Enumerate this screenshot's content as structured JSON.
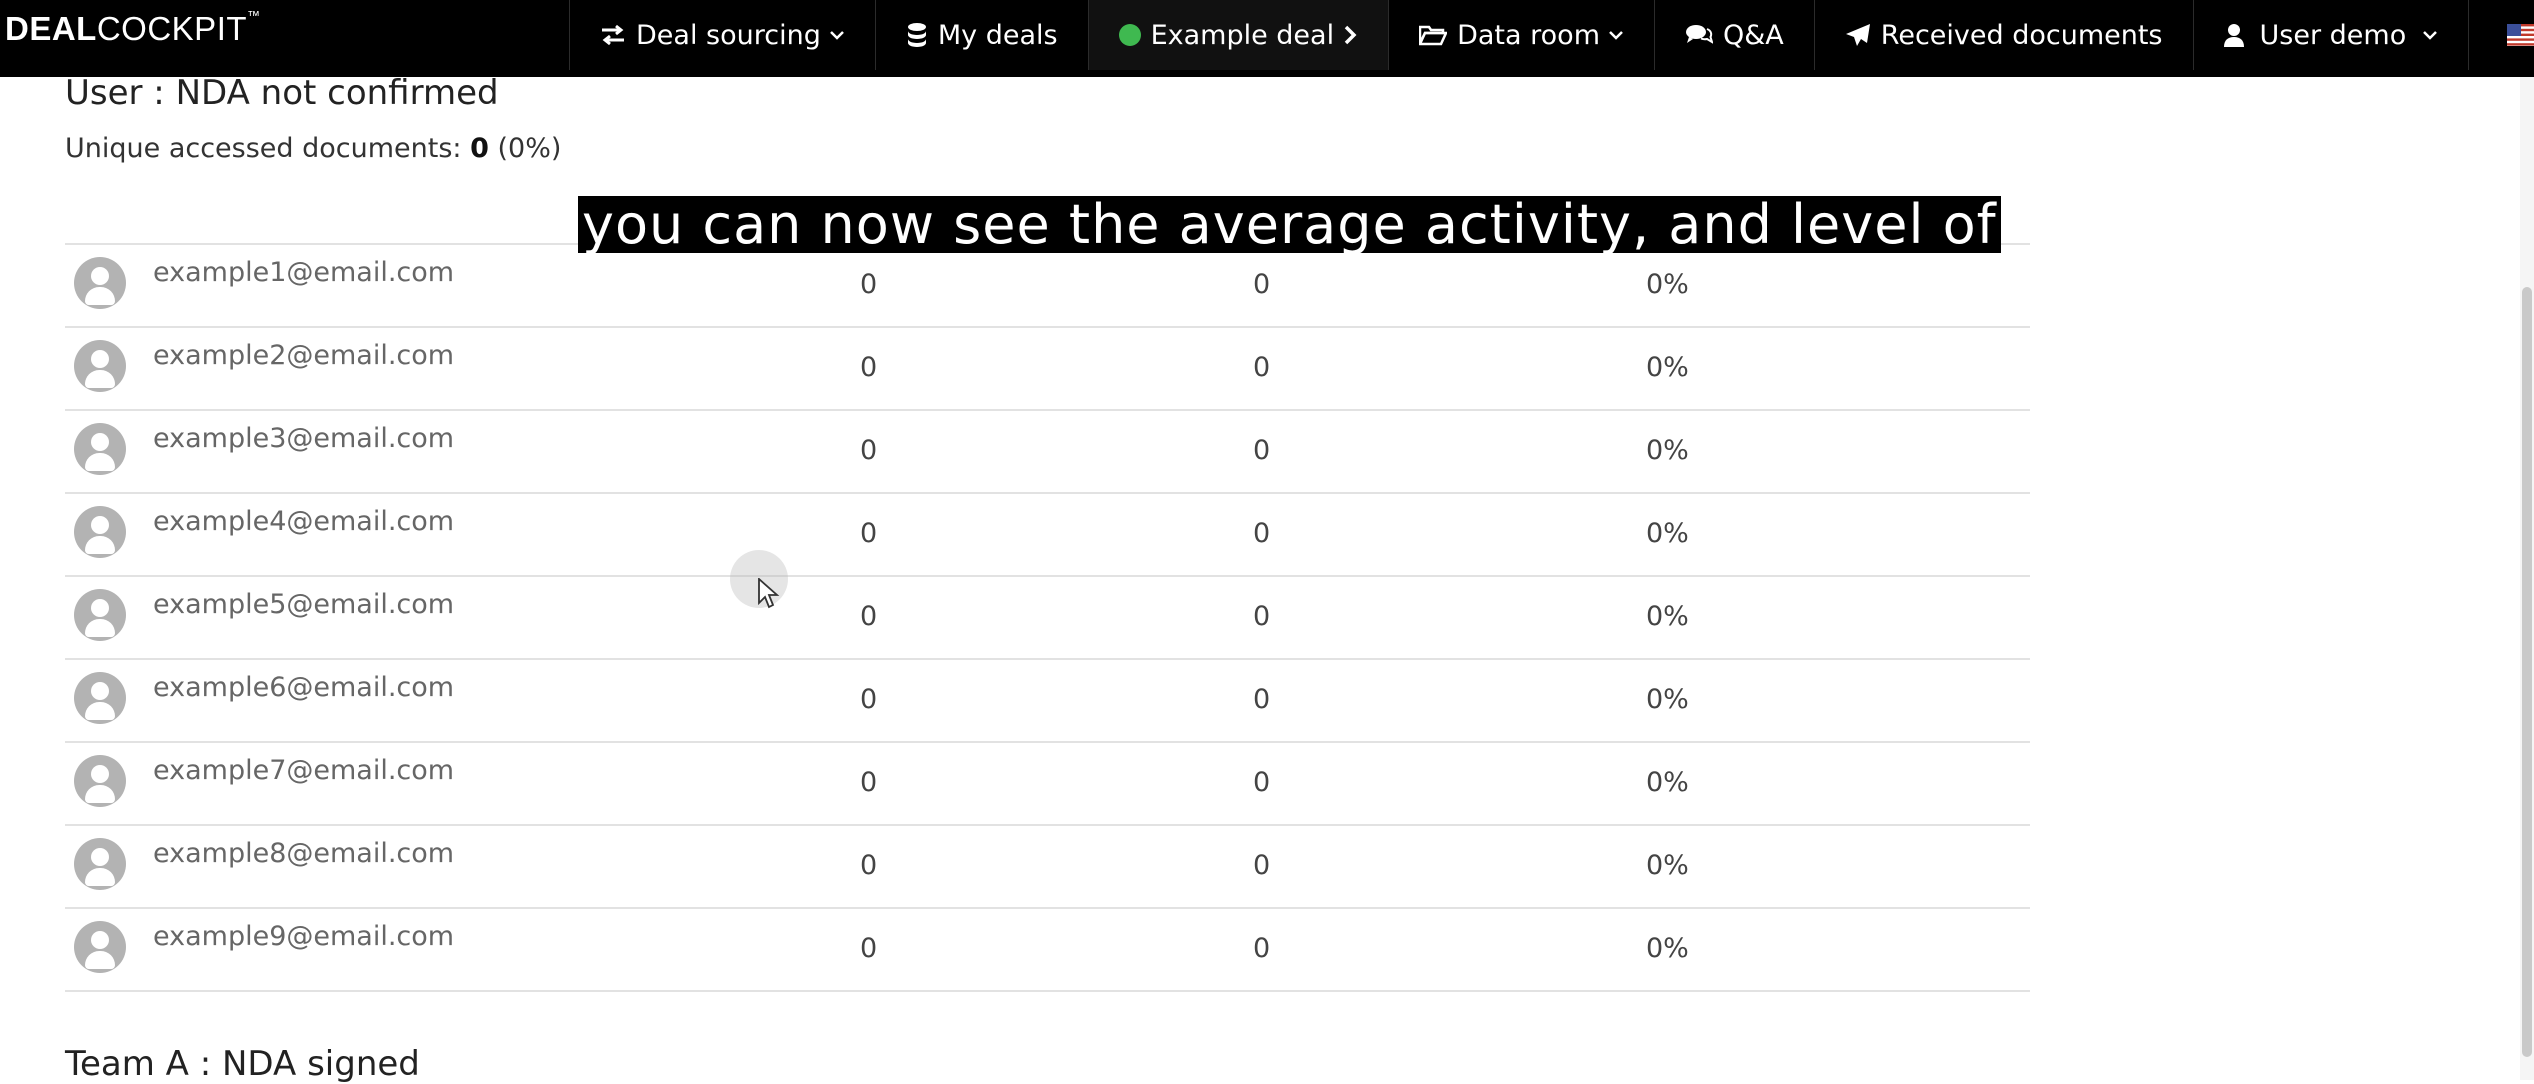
{
  "brand": {
    "bold": "DEAL",
    "light": "COCKPIT",
    "tm": "™"
  },
  "nav": [
    {
      "label": "Deal sourcing",
      "icon": "exchange-icon",
      "dropdown": true
    },
    {
      "label": "My deals",
      "icon": "database-icon",
      "dropdown": false
    },
    {
      "label": "Example deal",
      "icon": "status-dot-icon",
      "dropdown": false,
      "chevron_right": true
    },
    {
      "label": "Data room",
      "icon": "folder-open-icon",
      "dropdown": true
    },
    {
      "label": "Q&A",
      "icon": "comments-icon",
      "dropdown": false
    },
    {
      "label": "Received documents",
      "icon": "paper-plane-icon",
      "dropdown": false
    },
    {
      "label": "User demo",
      "icon": "user-icon",
      "dropdown": true
    },
    {
      "label": "",
      "icon": "us-flag-icon",
      "dropdown": true
    }
  ],
  "group": {
    "title": "User : NDA not confirmed",
    "stat_label": "Unique accessed documents:",
    "stat_value": "0",
    "stat_percent": "(0%)"
  },
  "rows": [
    {
      "email": "example1@email.com",
      "c1": "0",
      "c2": "0",
      "c3": "0%"
    },
    {
      "email": "example2@email.com",
      "c1": "0",
      "c2": "0",
      "c3": "0%"
    },
    {
      "email": "example3@email.com",
      "c1": "0",
      "c2": "0",
      "c3": "0%"
    },
    {
      "email": "example4@email.com",
      "c1": "0",
      "c2": "0",
      "c3": "0%"
    },
    {
      "email": "example5@email.com",
      "c1": "0",
      "c2": "0",
      "c3": "0%"
    },
    {
      "email": "example6@email.com",
      "c1": "0",
      "c2": "0",
      "c3": "0%"
    },
    {
      "email": "example7@email.com",
      "c1": "0",
      "c2": "0",
      "c3": "0%"
    },
    {
      "email": "example8@email.com",
      "c1": "0",
      "c2": "0",
      "c3": "0%"
    },
    {
      "email": "example9@email.com",
      "c1": "0",
      "c2": "0",
      "c3": "0%"
    }
  ],
  "next_group": {
    "title": "Team A : NDA signed"
  },
  "caption": "you can now see the average activity, and level of",
  "colors": {
    "navbar": "#000000",
    "status_dot": "#3fb950",
    "avatar": "#b3b3b3"
  }
}
